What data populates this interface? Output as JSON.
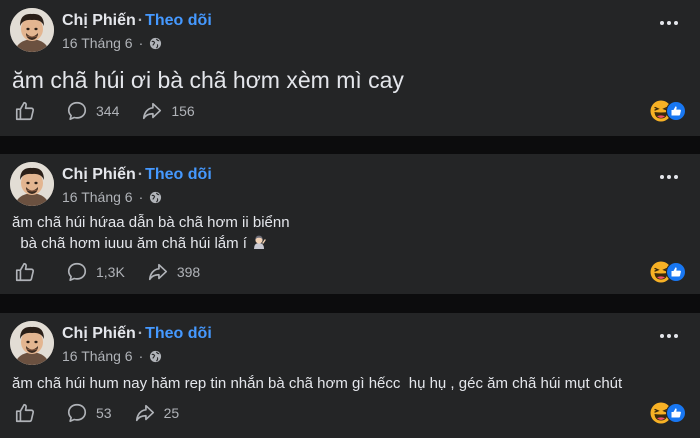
{
  "posts": [
    {
      "author": "Chị Phiến",
      "follow_label": "Theo dõi",
      "date": "16 Tháng 6",
      "text": "ăm chã húi ơi bà chã hơm xèm mì cay",
      "comments": "344",
      "shares": "156"
    },
    {
      "author": "Chị Phiến",
      "follow_label": "Theo dõi",
      "date": "16 Tháng 6",
      "text_line1": "ăm chã húi hứaa dẫn bà chã hơm ii biểnn",
      "text_line2": "  bà chã hơm iuuu ăm chã húi lắm í",
      "comments": "1,3K",
      "shares": "398"
    },
    {
      "author": "Chị Phiến",
      "follow_label": "Theo dõi",
      "date": "16 Tháng 6",
      "text": "ăm chã húi hum nay hăm rep tin nhắn bà chã hơm gì hếcc  hụ hụ , géc ăm chã húi mụt chút",
      "comments": "53",
      "shares": "25"
    }
  ],
  "icons": {
    "like": "thumbs-up-icon",
    "comment": "comment-bubble-icon",
    "share": "share-arrow-icon",
    "privacy": "globe-icon",
    "more": "more-options-icon",
    "reaction_haha": "haha-reaction-icon",
    "reaction_like": "like-reaction-icon",
    "emoji_in_text": "woman-gesturing-emoji"
  },
  "colors": {
    "background": "#0c0c0d",
    "card": "#242526",
    "text": "#e4e6eb",
    "secondary": "#b0b3b8",
    "link": "#4599ff",
    "like_blue": "#1877f2",
    "haha_yellow": "#f7b125"
  }
}
